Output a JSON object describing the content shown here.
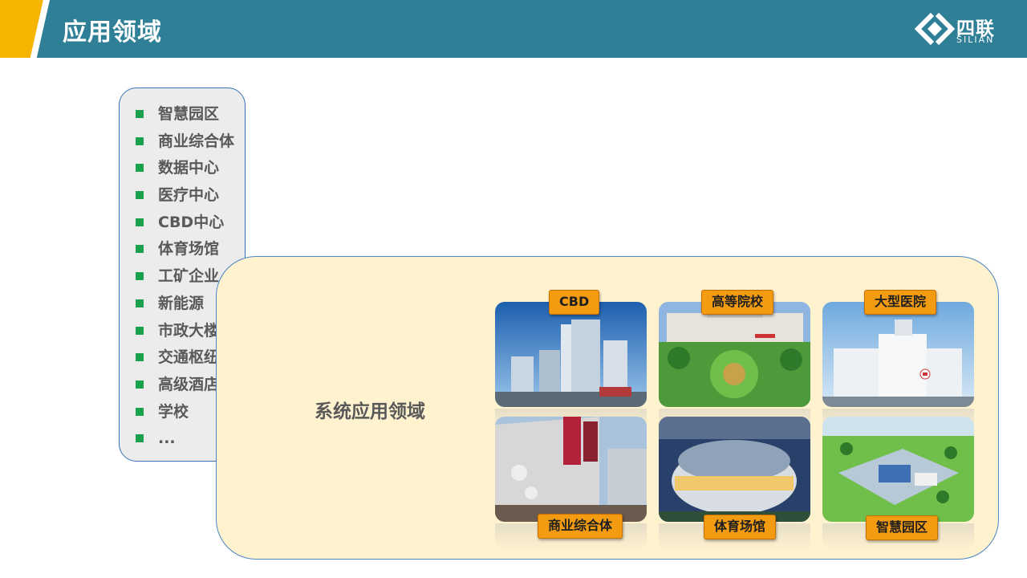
{
  "header": {
    "title": "应用领域"
  },
  "logo": {
    "name_cn": "四联",
    "name_en": "SILIAN"
  },
  "list": {
    "items": [
      "智慧园区",
      "商业综合体",
      "数据中心",
      "医疗中心",
      "CBD中心",
      "体育场馆",
      "工矿企业",
      "新能源",
      "市政大楼",
      "交通枢纽",
      "高级酒店",
      "学校",
      "..."
    ]
  },
  "main": {
    "label": "系统应用领域",
    "tiles": [
      {
        "label": "CBD"
      },
      {
        "label": "高等院校"
      },
      {
        "label": "大型医院"
      },
      {
        "label": "商业综合体"
      },
      {
        "label": "体育场馆"
      },
      {
        "label": "智慧园区"
      }
    ]
  },
  "colors": {
    "header": "#2f7f97",
    "accent": "#f5b400",
    "badge": "#f39c12",
    "bullet": "#1aa14b",
    "panel": "#fff2cf"
  }
}
